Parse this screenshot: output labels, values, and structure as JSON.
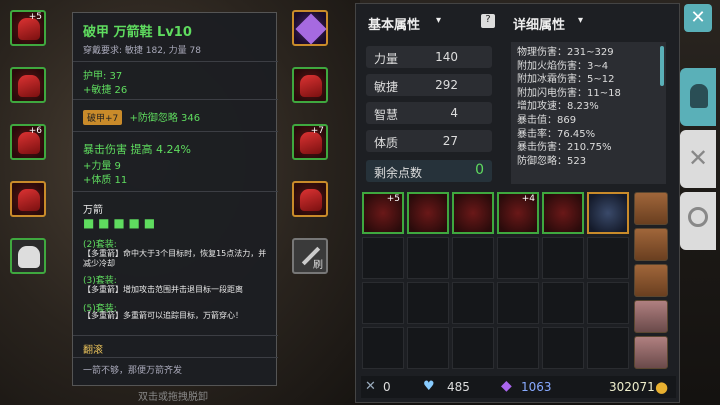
{
  "tooltip": {
    "title": "破甲 万箭鞋 Lv10",
    "requirement": "穿戴要求:   敏捷 182, 力量 78",
    "armor": "护甲:  37",
    "agi_bonus": "+敏捷  26",
    "enchant_badge": "破甲+7",
    "enchant_effect": "+防御忽略  346",
    "crit_line": "暴击伤害  提高  4.24%",
    "str_bonus": "+力量  9",
    "vit_bonus": "+体质  11",
    "set_name": "万箭",
    "set2_label": "(2)套装:",
    "set2_text": "【多重箭】命中大于3个目标时，恢复15点法力，并减少冷却",
    "set3_label": "(3)套装:",
    "set3_text": "【多重箭】增加攻击范围并击退目标一段距离",
    "set5_label": "(5)套装:",
    "set5_text": "【多重箭】多重箭可以追踪目标，万箭穿心！",
    "subtitle": "翻滚",
    "flavor": "一箭不够，那便万箭齐发"
  },
  "hint": "双击或拖拽脱卸",
  "paint_label": "刷",
  "left_slots": [
    {
      "plus": "+5"
    },
    {
      "plus": ""
    },
    {
      "plus": "+6"
    },
    {
      "plus": ""
    },
    {
      "plus": ""
    }
  ],
  "right_slots": [
    {
      "plus": ""
    },
    {
      "plus": ""
    },
    {
      "plus": "+7"
    },
    {
      "plus": ""
    }
  ],
  "basic": {
    "title": "基本属性",
    "items": [
      {
        "label": "力量",
        "value": "140"
      },
      {
        "label": "敏捷",
        "value": "292"
      },
      {
        "label": "智慧",
        "value": "4"
      },
      {
        "label": "体质",
        "value": "27"
      }
    ],
    "remaining_label": "剩余点数",
    "remaining_value": "0"
  },
  "detail": {
    "title": "详细属性",
    "lines": [
      "物理伤害：231~329",
      "附加火焰伤害：3~4",
      "附加冰霜伤害：5~12",
      "附加闪电伤害：11~18",
      "增加攻速：8.23%",
      "暴击值：869",
      "暴击率：76.45%",
      "暴击伤害：210.75%",
      "防御忽略：523"
    ]
  },
  "inventory": {
    "row1_plus": [
      "+5",
      "",
      "",
      "+4",
      "",
      ""
    ]
  },
  "currency": {
    "keys": "0",
    "potion": "485",
    "gems": "1063",
    "gold": "302071"
  },
  "colors": {
    "green": "#3fa83f",
    "gold": "#c98b2a",
    "teal": "#5ab0b8"
  }
}
